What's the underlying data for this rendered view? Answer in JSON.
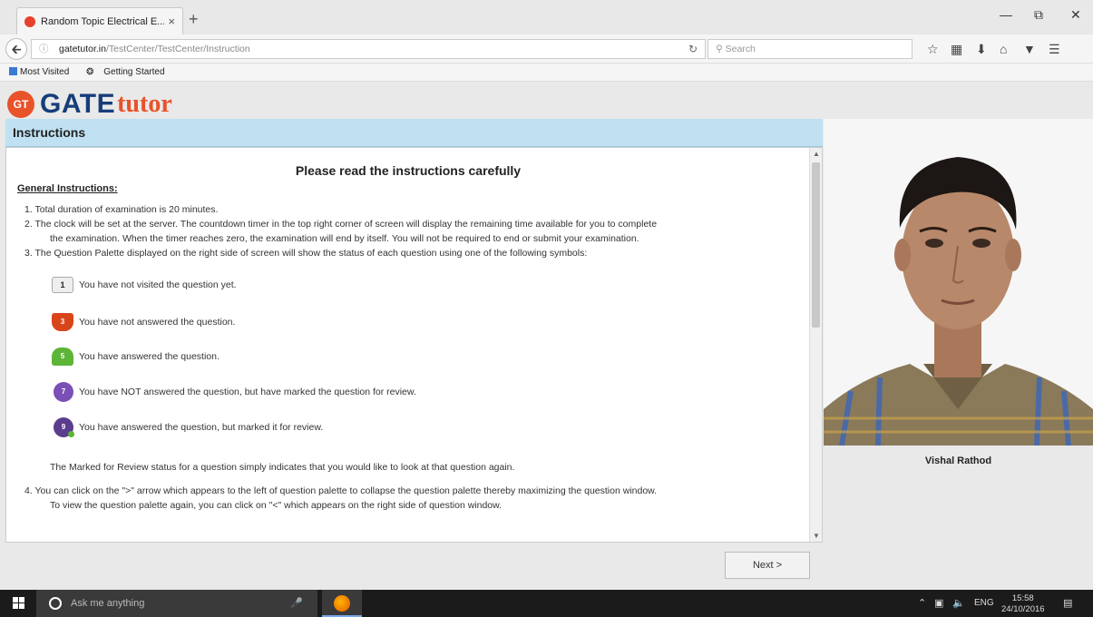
{
  "browser": {
    "tab_title": "Random Topic Electrical E...",
    "tab_close": "×",
    "new_tab": "+",
    "url_host": "gatetutor.in",
    "url_path": "/TestCenter/TestCenter/Instruction",
    "search_placeholder": "Search",
    "bookmarks": [
      "Most Visited",
      "Getting Started"
    ]
  },
  "logo": {
    "badge": "GT",
    "gate": "GATE",
    "tutor": "tutor"
  },
  "instructions": {
    "header": "Instructions",
    "heading": "Please read the instructions carefully",
    "general_title": "General Instructions:",
    "item1": "1. Total duration of examination is 20 minutes.",
    "item2a": "2. The clock will be set at the server. The countdown timer in the top right corner of screen will display the remaining time available for you to complete",
    "item2b": "the examination. When the timer reaches zero, the examination will end by itself. You will not be required to end or submit your examination.",
    "item3": "3. The Question Palette displayed on the right side of screen will show the status of each question using one of the following symbols:",
    "symbols": [
      {
        "num": "1",
        "text": "You have not visited the question yet."
      },
      {
        "num": "3",
        "text": "You have not answered the question."
      },
      {
        "num": "5",
        "text": "You have answered the question."
      },
      {
        "num": "7",
        "text": "You have NOT answered the question, but have marked the question for review."
      },
      {
        "num": "9",
        "text": "You have answered the question, but marked it for review."
      }
    ],
    "review_note": "The Marked for Review status for a question simply indicates that you would like to look at that question again.",
    "item4a": "4. You can click on the \">\" arrow which appears to the left of question palette to collapse the question palette thereby maximizing the question window.",
    "item4b": "To view the question palette again, you can click on \"<\" which appears on the right side of question window."
  },
  "buttons": {
    "next": "Next >"
  },
  "candidate": {
    "name": "Vishal Rathod"
  },
  "taskbar": {
    "search_text": "Ask me anything",
    "lang": "ENG",
    "time": "15:58",
    "date": "24/10/2016"
  }
}
